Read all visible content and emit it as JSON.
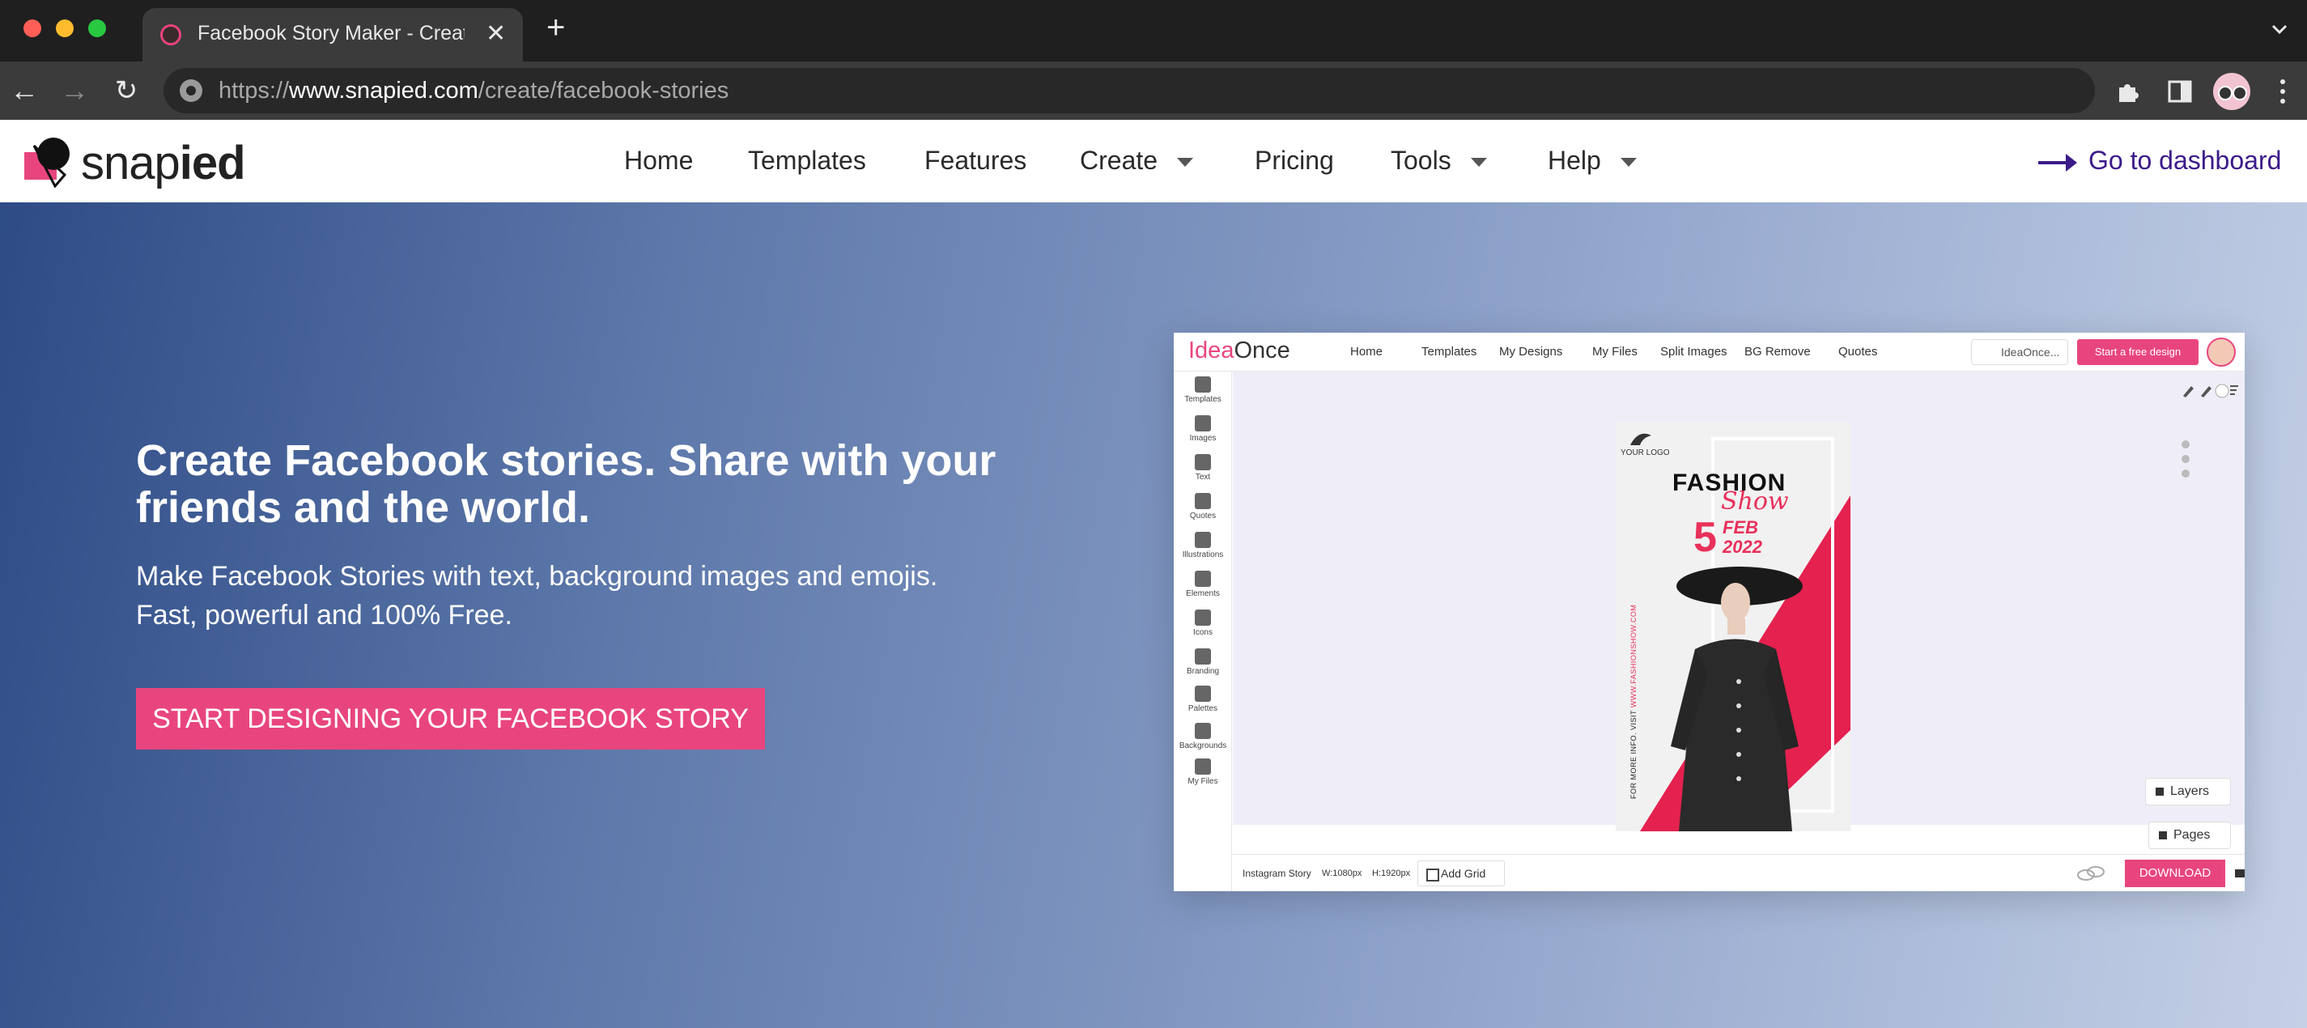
{
  "browser": {
    "tab_title": "Facebook Story Maker - Create",
    "url_prefix": "https://",
    "url_host": "www.snapied.com",
    "url_path": "/create/facebook-stories"
  },
  "site": {
    "logo": {
      "light": "snap",
      "bold": "ied"
    },
    "nav": {
      "home": "Home",
      "templates": "Templates",
      "features": "Features",
      "create": "Create",
      "pricing": "Pricing",
      "tools": "Tools",
      "help": "Help"
    },
    "dashboard_link": "Go to dashboard",
    "accent_color": "#e8457e",
    "link_color": "#3b1a8a"
  },
  "hero": {
    "title": "Create Facebook stories. Share with your friends and the world.",
    "subtitle_line1": "Make Facebook Stories with text, background images and emojis.",
    "subtitle_line2": "Fast, powerful and 100% Free.",
    "cta": "START DESIGNING YOUR FACEBOOK STORY"
  },
  "mockup": {
    "logo_a": "Idea",
    "logo_b": "Once",
    "nav": {
      "home": "Home",
      "templates": "Templates",
      "my_designs": "My Designs",
      "my_files": "My Files",
      "split_images": "Split Images",
      "bg_remove": "BG Remove",
      "quotes": "Quotes"
    },
    "user_label": "IdeaOnce...",
    "free_design": "Start a free design",
    "sidebar": {
      "templates": "Templates",
      "images": "Images",
      "text": "Text",
      "quotes": "Quotes",
      "illustrations": "Illustrations",
      "elements": "Elements",
      "icons": "Icons",
      "branding": "Branding",
      "palettes": "Palettes",
      "backgrounds": "Backgrounds",
      "my_files": "My Files"
    },
    "poster": {
      "logo": "YOUR LOGO",
      "fashion": "FASHION",
      "show": "Show",
      "day": "5",
      "month": "FEB",
      "year": "2022",
      "vertical_text": "FOR MORE INFO. VISIT",
      "vertical_url": "WWW.FASHIONSHOW.COM"
    },
    "layers": "Layers",
    "pages": "Pages",
    "bottom": {
      "format": "Instagram Story",
      "width": "W:1080px",
      "height": "H:1920px",
      "add_grid": "Add Grid",
      "download": "DOWNLOAD"
    }
  }
}
